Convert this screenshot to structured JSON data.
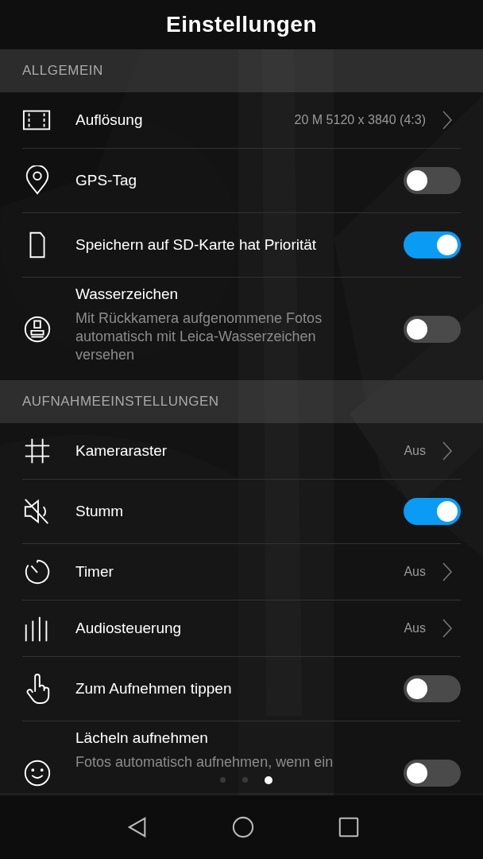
{
  "header": {
    "title": "Einstellungen"
  },
  "sections": [
    {
      "title": "ALLGEMEIN",
      "items": [
        {
          "kind": "link",
          "label": "Auflösung",
          "value": "20 M 5120 x 3840 (4:3)"
        },
        {
          "kind": "toggle",
          "label": "GPS-Tag",
          "on": false
        },
        {
          "kind": "toggle",
          "label": "Speichern auf SD-Karte hat Priorität",
          "on": true
        },
        {
          "kind": "toggle",
          "label": "Wasserzeichen",
          "description": "Mit Rückkamera aufgenommene Fotos automatisch mit Leica-Wasserzeichen versehen",
          "on": false
        }
      ]
    },
    {
      "title": "AUFNAHMEEINSTELLUNGEN",
      "items": [
        {
          "kind": "link",
          "label": "Kameraraster",
          "value": "Aus"
        },
        {
          "kind": "toggle",
          "label": "Stumm",
          "on": true
        },
        {
          "kind": "link",
          "label": "Timer",
          "value": "Aus"
        },
        {
          "kind": "link",
          "label": "Audiosteuerung",
          "value": "Aus"
        },
        {
          "kind": "toggle",
          "label": "Zum Aufnehmen tippen",
          "on": false
        },
        {
          "kind": "toggle",
          "label": "Lächeln aufnehmen",
          "description": "Fotos automatisch aufnehmen, wenn ein",
          "on": false
        }
      ]
    }
  ],
  "pages": [
    {
      "selected": false
    },
    {
      "selected": false
    },
    {
      "selected": true
    }
  ]
}
